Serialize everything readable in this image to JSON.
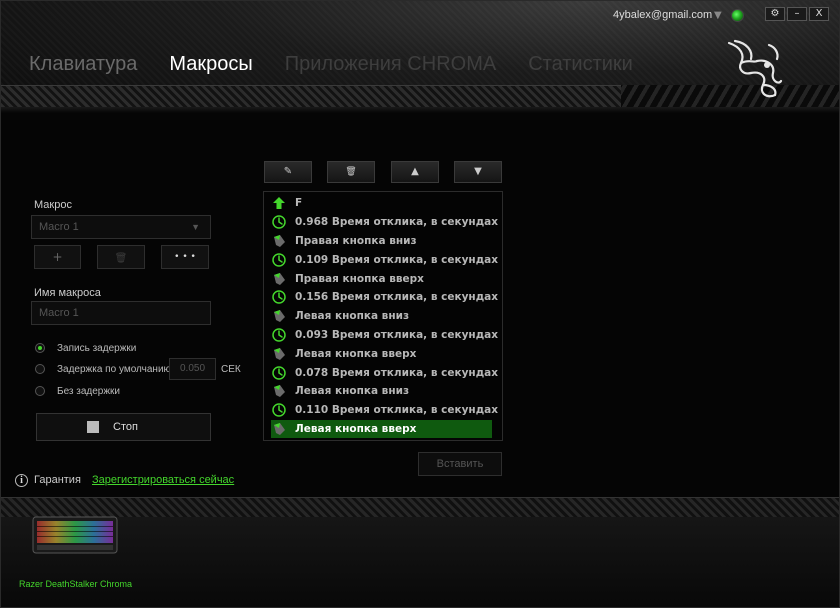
{
  "header": {
    "account_email": "4ybalex@gmail.com",
    "account_arrow": "▼",
    "window_buttons": {
      "settings": "⚙",
      "minimize": "–",
      "close": "X"
    },
    "tabs": [
      {
        "label": "Клавиатура"
      },
      {
        "label": "Макросы"
      },
      {
        "label": "Приложения CHROMA"
      },
      {
        "label": "Статистики"
      }
    ]
  },
  "left": {
    "macro_label": "Макрос",
    "macro_select_value": "Macro 1",
    "add_btn": "+",
    "delete_btn": "🗑",
    "more_btn": "• • •",
    "name_label": "Имя макроса",
    "name_value": "Macro 1",
    "options": [
      {
        "label": "Запись задержки"
      },
      {
        "label": "Задержка по умолчанию"
      },
      {
        "label": "Без задержки"
      }
    ],
    "default_delay_value": "0.050",
    "delay_unit": "СЕК",
    "stop_label": "Стоп"
  },
  "toolbar": {
    "edit": "✎",
    "delete": "🗑",
    "up": "▲",
    "down": "▼"
  },
  "macro_list": [
    {
      "icon": "arrow-up-icon",
      "text": "F"
    },
    {
      "icon": "clock-icon",
      "text": "0.968 Время отклика, в секундах"
    },
    {
      "icon": "mouse-icon",
      "text": "Правая кнопка вниз"
    },
    {
      "icon": "clock-icon",
      "text": "0.109 Время отклика, в секундах"
    },
    {
      "icon": "mouse-icon",
      "text": "Правая кнопка вверх"
    },
    {
      "icon": "clock-icon",
      "text": "0.156 Время отклика, в секундах"
    },
    {
      "icon": "mouse-icon",
      "text": "Левая кнопка вниз"
    },
    {
      "icon": "clock-icon",
      "text": "0.093 Время отклика, в секундах"
    },
    {
      "icon": "mouse-icon",
      "text": "Левая кнопка вверх"
    },
    {
      "icon": "clock-icon",
      "text": "0.078 Время отклика, в секундах"
    },
    {
      "icon": "mouse-icon",
      "text": "Левая кнопка вниз"
    },
    {
      "icon": "clock-icon",
      "text": "0.110 Время отклика, в секундах"
    },
    {
      "icon": "mouse-icon",
      "text": "Левая кнопка вверх"
    }
  ],
  "insert_label": "Вставить",
  "warranty": {
    "info": "i",
    "label": "Гарантия",
    "link": "Зарегистрироваться сейчас"
  },
  "device_name": "Razer DeathStalker Chroma",
  "colors": {
    "accent": "#44d62c",
    "selected_row": "#0f5a0f"
  }
}
